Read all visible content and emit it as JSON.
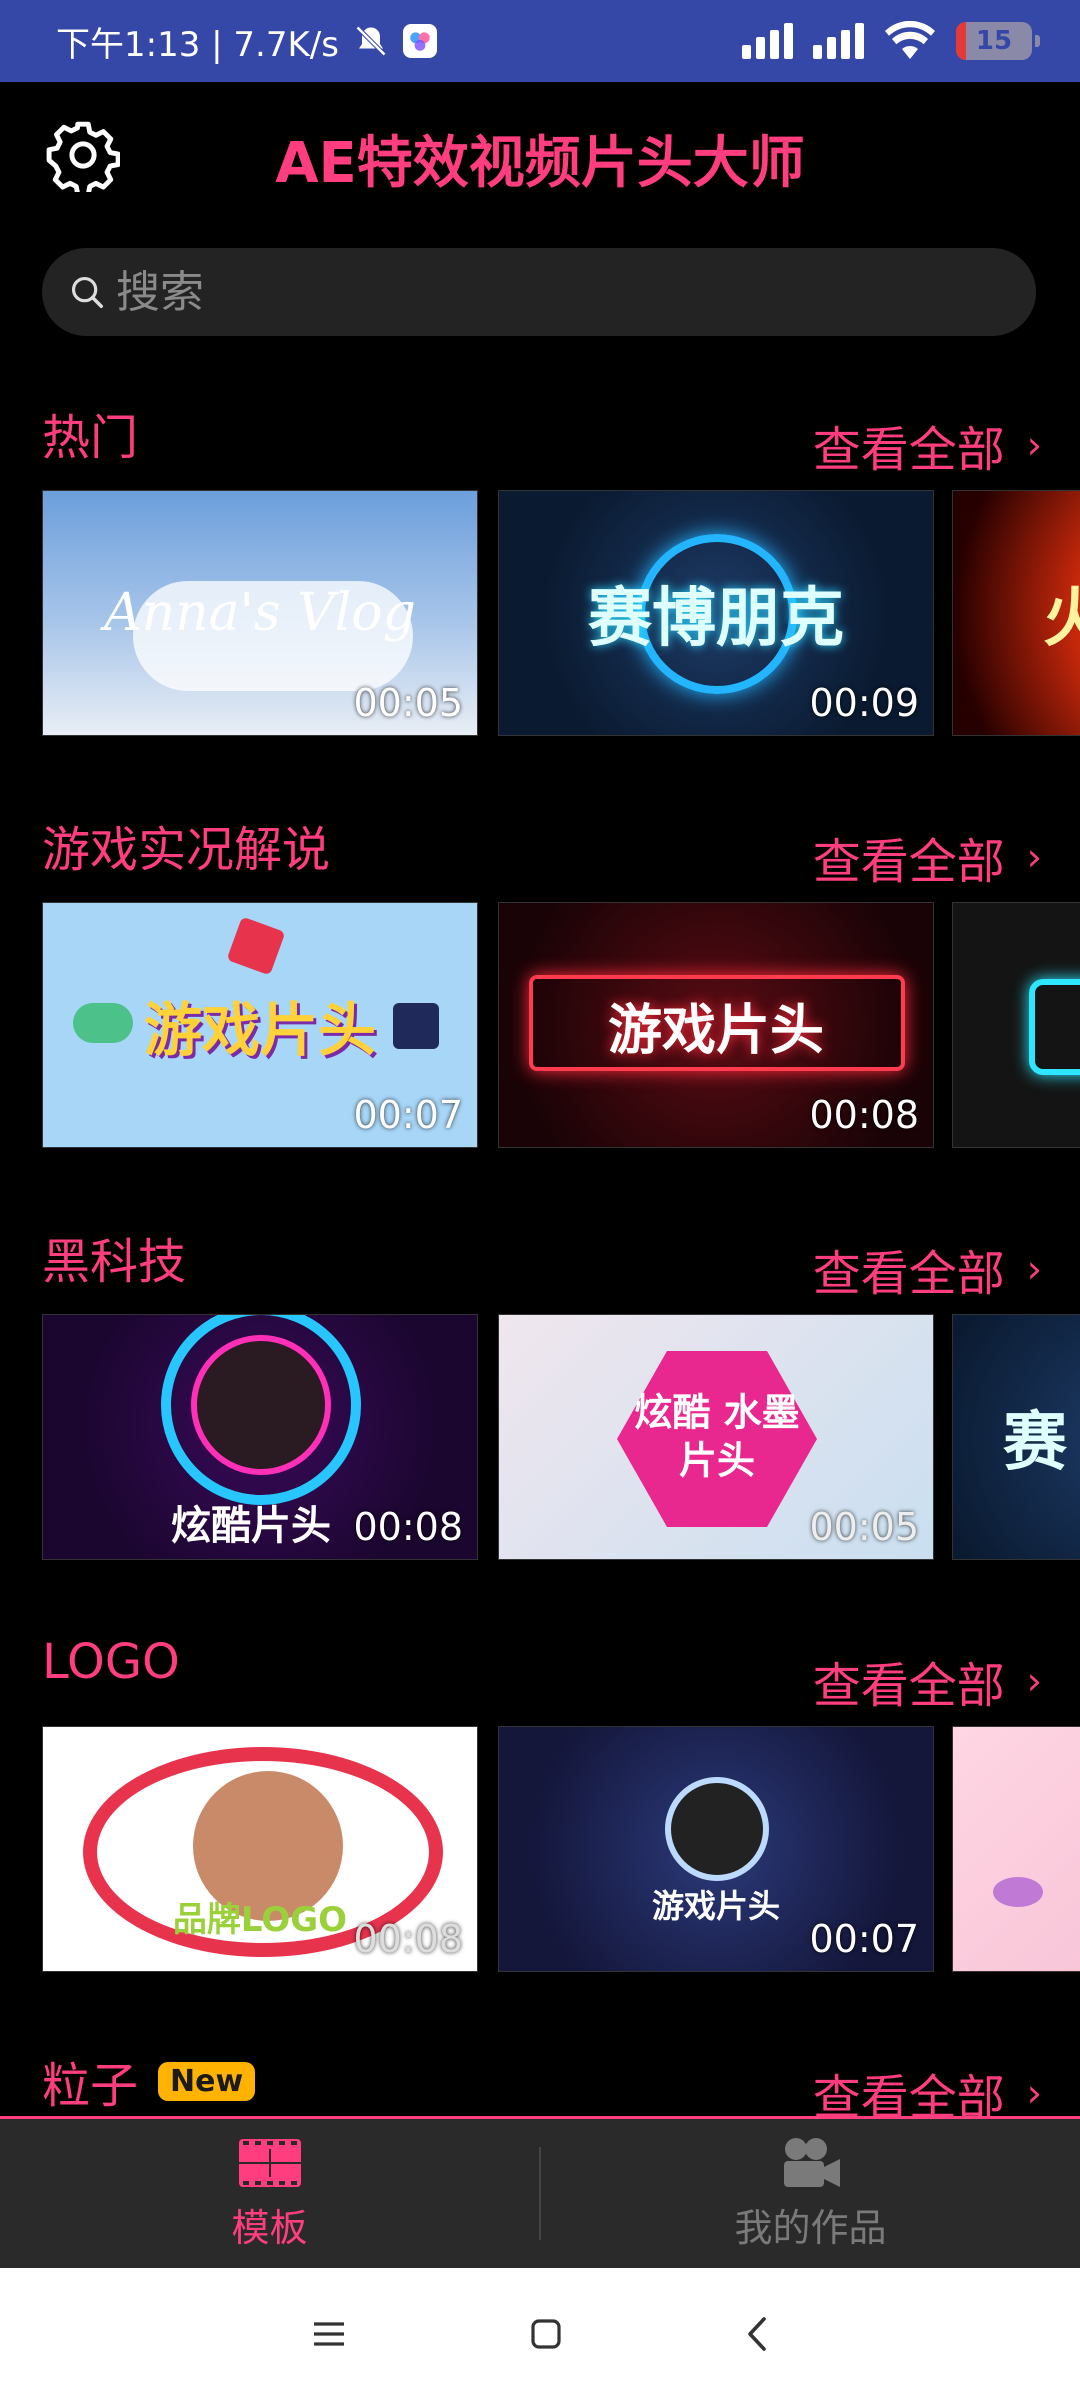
{
  "status": {
    "time_speed": "下午1:13 | 7.7K/s",
    "battery": "15"
  },
  "header": {
    "title": "AE特效视频片头大师"
  },
  "search": {
    "placeholder": "搜索"
  },
  "sections": [
    {
      "title": "热门",
      "see_all": "查看全部",
      "badge": "",
      "cards": [
        {
          "text": "Anna's Vlog",
          "duration": "00:05"
        },
        {
          "text": "赛博朋克",
          "duration": "00:09"
        },
        {
          "text": "火",
          "duration": ""
        }
      ]
    },
    {
      "title": "游戏实况解说",
      "see_all": "查看全部",
      "badge": "",
      "cards": [
        {
          "text": "游戏片头",
          "duration": "00:07"
        },
        {
          "text": "游戏片头",
          "duration": "00:08"
        },
        {
          "text": "",
          "duration": ""
        }
      ]
    },
    {
      "title": "黑科技",
      "see_all": "查看全部",
      "badge": "",
      "cards": [
        {
          "text": "炫酷片头",
          "duration": "00:08"
        },
        {
          "text": "炫酷 水墨片头",
          "duration": "00:05"
        },
        {
          "text": "赛",
          "duration": ""
        }
      ]
    },
    {
      "title": "LOGO",
      "see_all": "查看全部",
      "badge": "",
      "cards": [
        {
          "text": "品牌LOGO",
          "duration": "00:08"
        },
        {
          "text": "游戏片头",
          "duration": "00:07"
        },
        {
          "text": "",
          "duration": ""
        }
      ]
    },
    {
      "title": "粒子",
      "see_all": "查看全部",
      "badge": "New",
      "cards": []
    }
  ],
  "bottom_nav": {
    "items": [
      {
        "label": "模板",
        "icon": "template-icon",
        "active": true
      },
      {
        "label": "我的作品",
        "icon": "video-camera-icon",
        "active": false
      }
    ]
  },
  "colors": {
    "accent": "#ff3d7f",
    "status_bar": "#3548a8",
    "nav_bg": "#2a2a2a"
  }
}
